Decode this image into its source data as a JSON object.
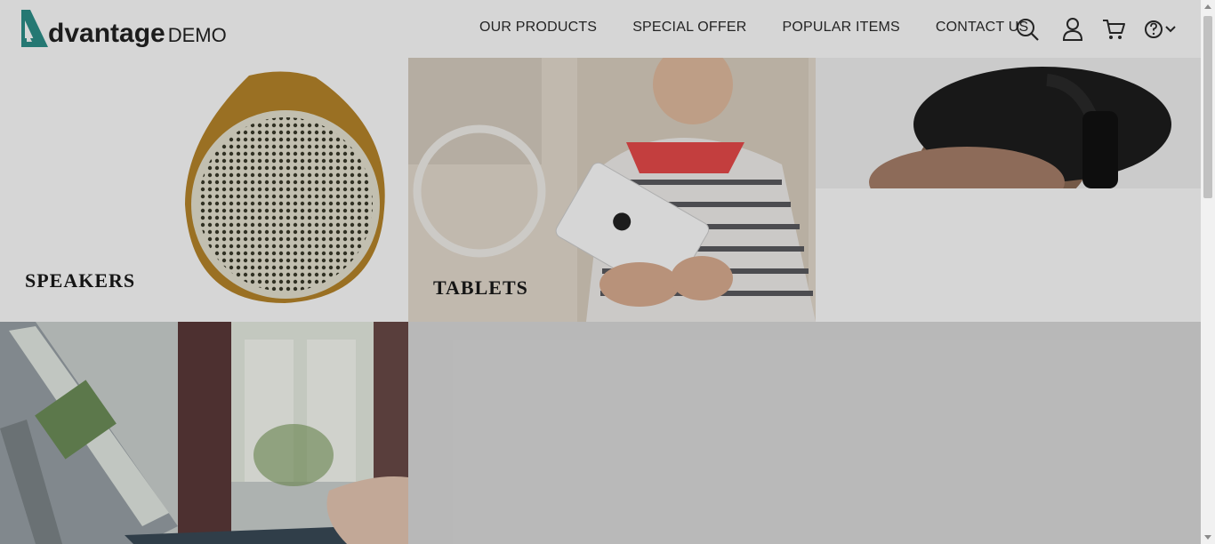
{
  "logo": {
    "brand": "dvantage",
    "suffix": "DEMO"
  },
  "nav": {
    "items": [
      {
        "label": "OUR PRODUCTS"
      },
      {
        "label": "SPECIAL OFFER"
      },
      {
        "label": "POPULAR ITEMS"
      },
      {
        "label": "CONTACT US"
      }
    ]
  },
  "header_icons": [
    "search-icon",
    "user-icon",
    "cart-icon",
    "help-icon",
    "chevron-down-icon"
  ],
  "categories": {
    "speakers": {
      "label": "SPEAKERS"
    },
    "tablets": {
      "label": "TABLETS"
    }
  },
  "colors": {
    "brand_teal": "#2d8f8a",
    "overlay": "rgba(0,0,0,0.16)"
  }
}
